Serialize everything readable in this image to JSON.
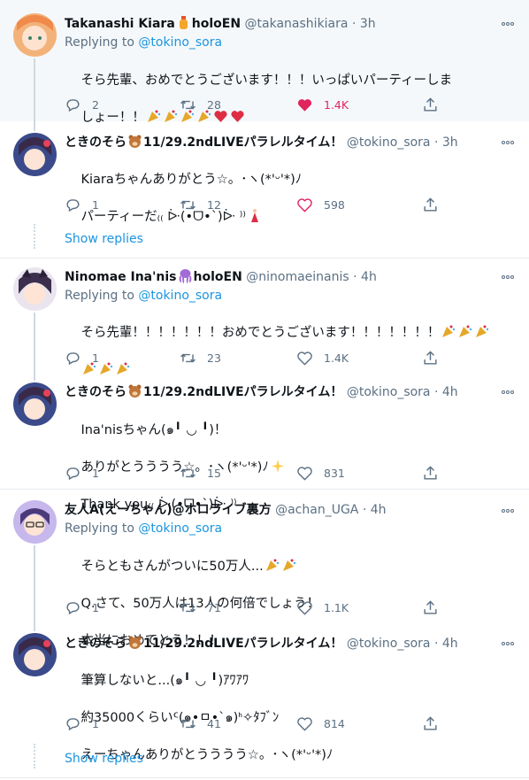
{
  "tweets": [
    {
      "name": "Takanashi Kiara",
      "name_suffix": "holoEN",
      "handle": "@takanashikiara",
      "time": "· 3h",
      "replying_label": "Replying to",
      "replying_to": "@tokino_sora",
      "text_line1": "そら先輩、おめでとうございます！！！いっぱいパーティーしま",
      "text_line2": "しょー！！",
      "replies": "2",
      "retweets": "28",
      "likes": "1.4K",
      "liked": true
    },
    {
      "name": "ときのそら",
      "name_suffix": "11/29.2ndLIVEパラレルタイム！",
      "handle": "@tokino_sora",
      "time": "· 3h",
      "text_line1": "Kiaraちゃんありがとう☆。･ヽ(*'ᵕ'*)ﾉ",
      "text_line2": "パーティーだ₍₍ ᐕ(•ᗜ•`)ᐕ ⁾⁾",
      "replies": "1",
      "retweets": "12",
      "likes": "598"
    },
    {
      "name": "Ninomae Ina'nis",
      "name_suffix": "holoEN",
      "handle": "@ninomaeinanis",
      "time": "· 4h",
      "replying_label": "Replying to",
      "replying_to": "@tokino_sora",
      "text_line1": "そら先輩！！！！！！！おめでとうございます！！！！！！！",
      "text_line2": "",
      "replies": "1",
      "retweets": "23",
      "likes": "1.4K"
    },
    {
      "name": "ときのそら",
      "name_suffix": "11/29.2ndLIVEパラレルタイム！",
      "handle": "@tokino_sora",
      "time": "· 4h",
      "text_line1": "Ina'nisちゃん(๑╹ ◡ ╹)！",
      "text_line2": "ありがとうううう☆。･ヽ(*'ᵕ'*)ﾉ",
      "text_line3": "Thank you₍₍ ᐕ(•ᗜ•`)ᐕ ⁾⁾",
      "replies": "1",
      "retweets": "15",
      "likes": "831"
    },
    {
      "name": "友人A(えーちゃん)@ホロライブ裏方",
      "handle": "@achan_UGA",
      "time": "· 4h",
      "replying_label": "Replying to",
      "replying_to": "@tokino_sora",
      "text_line1": "そらともさんがついに50万人...",
      "text_line2": "Q.さて、50万人は13人の何倍でしょう！",
      "text_line3": "本当におめでとう！！！",
      "replies": "1",
      "retweets": "71",
      "likes": "1.1K"
    },
    {
      "name": "ときのそら",
      "name_suffix": "11/29.2ndLIVEパラレルタイム！",
      "handle": "@tokino_sora",
      "time": "· 4h",
      "text_line1": "筆算しないと...(๑╹ ◡ ╹)ｱﾜｱﾜ",
      "text_line2": "約35000くらいᑦ(๑•ㅁ•`๑)ᑋ✧ﾀﾌﾞﾝ",
      "text_line3": "えーちゃんありがとうううう☆。･ヽ(*'ᵕ'*)ﾉ",
      "replies": "1",
      "retweets": "41",
      "likes": "814"
    }
  ],
  "show_replies": "Show replies",
  "colors": {
    "accent": "#1b95e0",
    "like_red": "#e0245e",
    "muted": "#5b7083",
    "highlight_bg": "#f5f8fa"
  }
}
